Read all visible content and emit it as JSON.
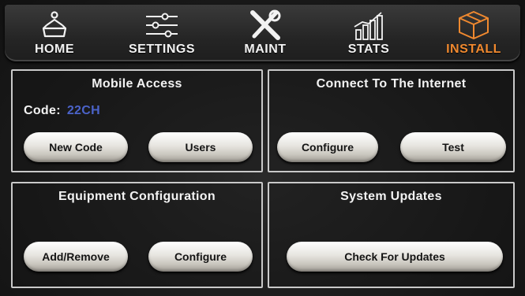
{
  "tabs": [
    {
      "label": "HOME",
      "icon": "home-icon"
    },
    {
      "label": "SETTINGS",
      "icon": "sliders-icon"
    },
    {
      "label": "MAINT",
      "icon": "wrench-icon"
    },
    {
      "label": "STATS",
      "icon": "bar-chart-icon"
    },
    {
      "label": "INSTALL",
      "icon": "cube-icon",
      "active": true
    }
  ],
  "mobile_access": {
    "title": "Mobile Access",
    "code_label": "Code:",
    "code_value": "22CH",
    "buttons": [
      "New Code",
      "Users"
    ]
  },
  "internet": {
    "title": "Connect To The Internet",
    "buttons": [
      "Configure",
      "Test"
    ]
  },
  "equipment": {
    "title": "Equipment Configuration",
    "buttons": [
      "Add/Remove",
      "Configure"
    ]
  },
  "updates": {
    "title": "System Updates",
    "buttons": [
      "Check For Updates"
    ]
  },
  "colors": {
    "accent": "#f0892f",
    "code": "#4b63c9",
    "panel_border": "#c9c9c9"
  }
}
